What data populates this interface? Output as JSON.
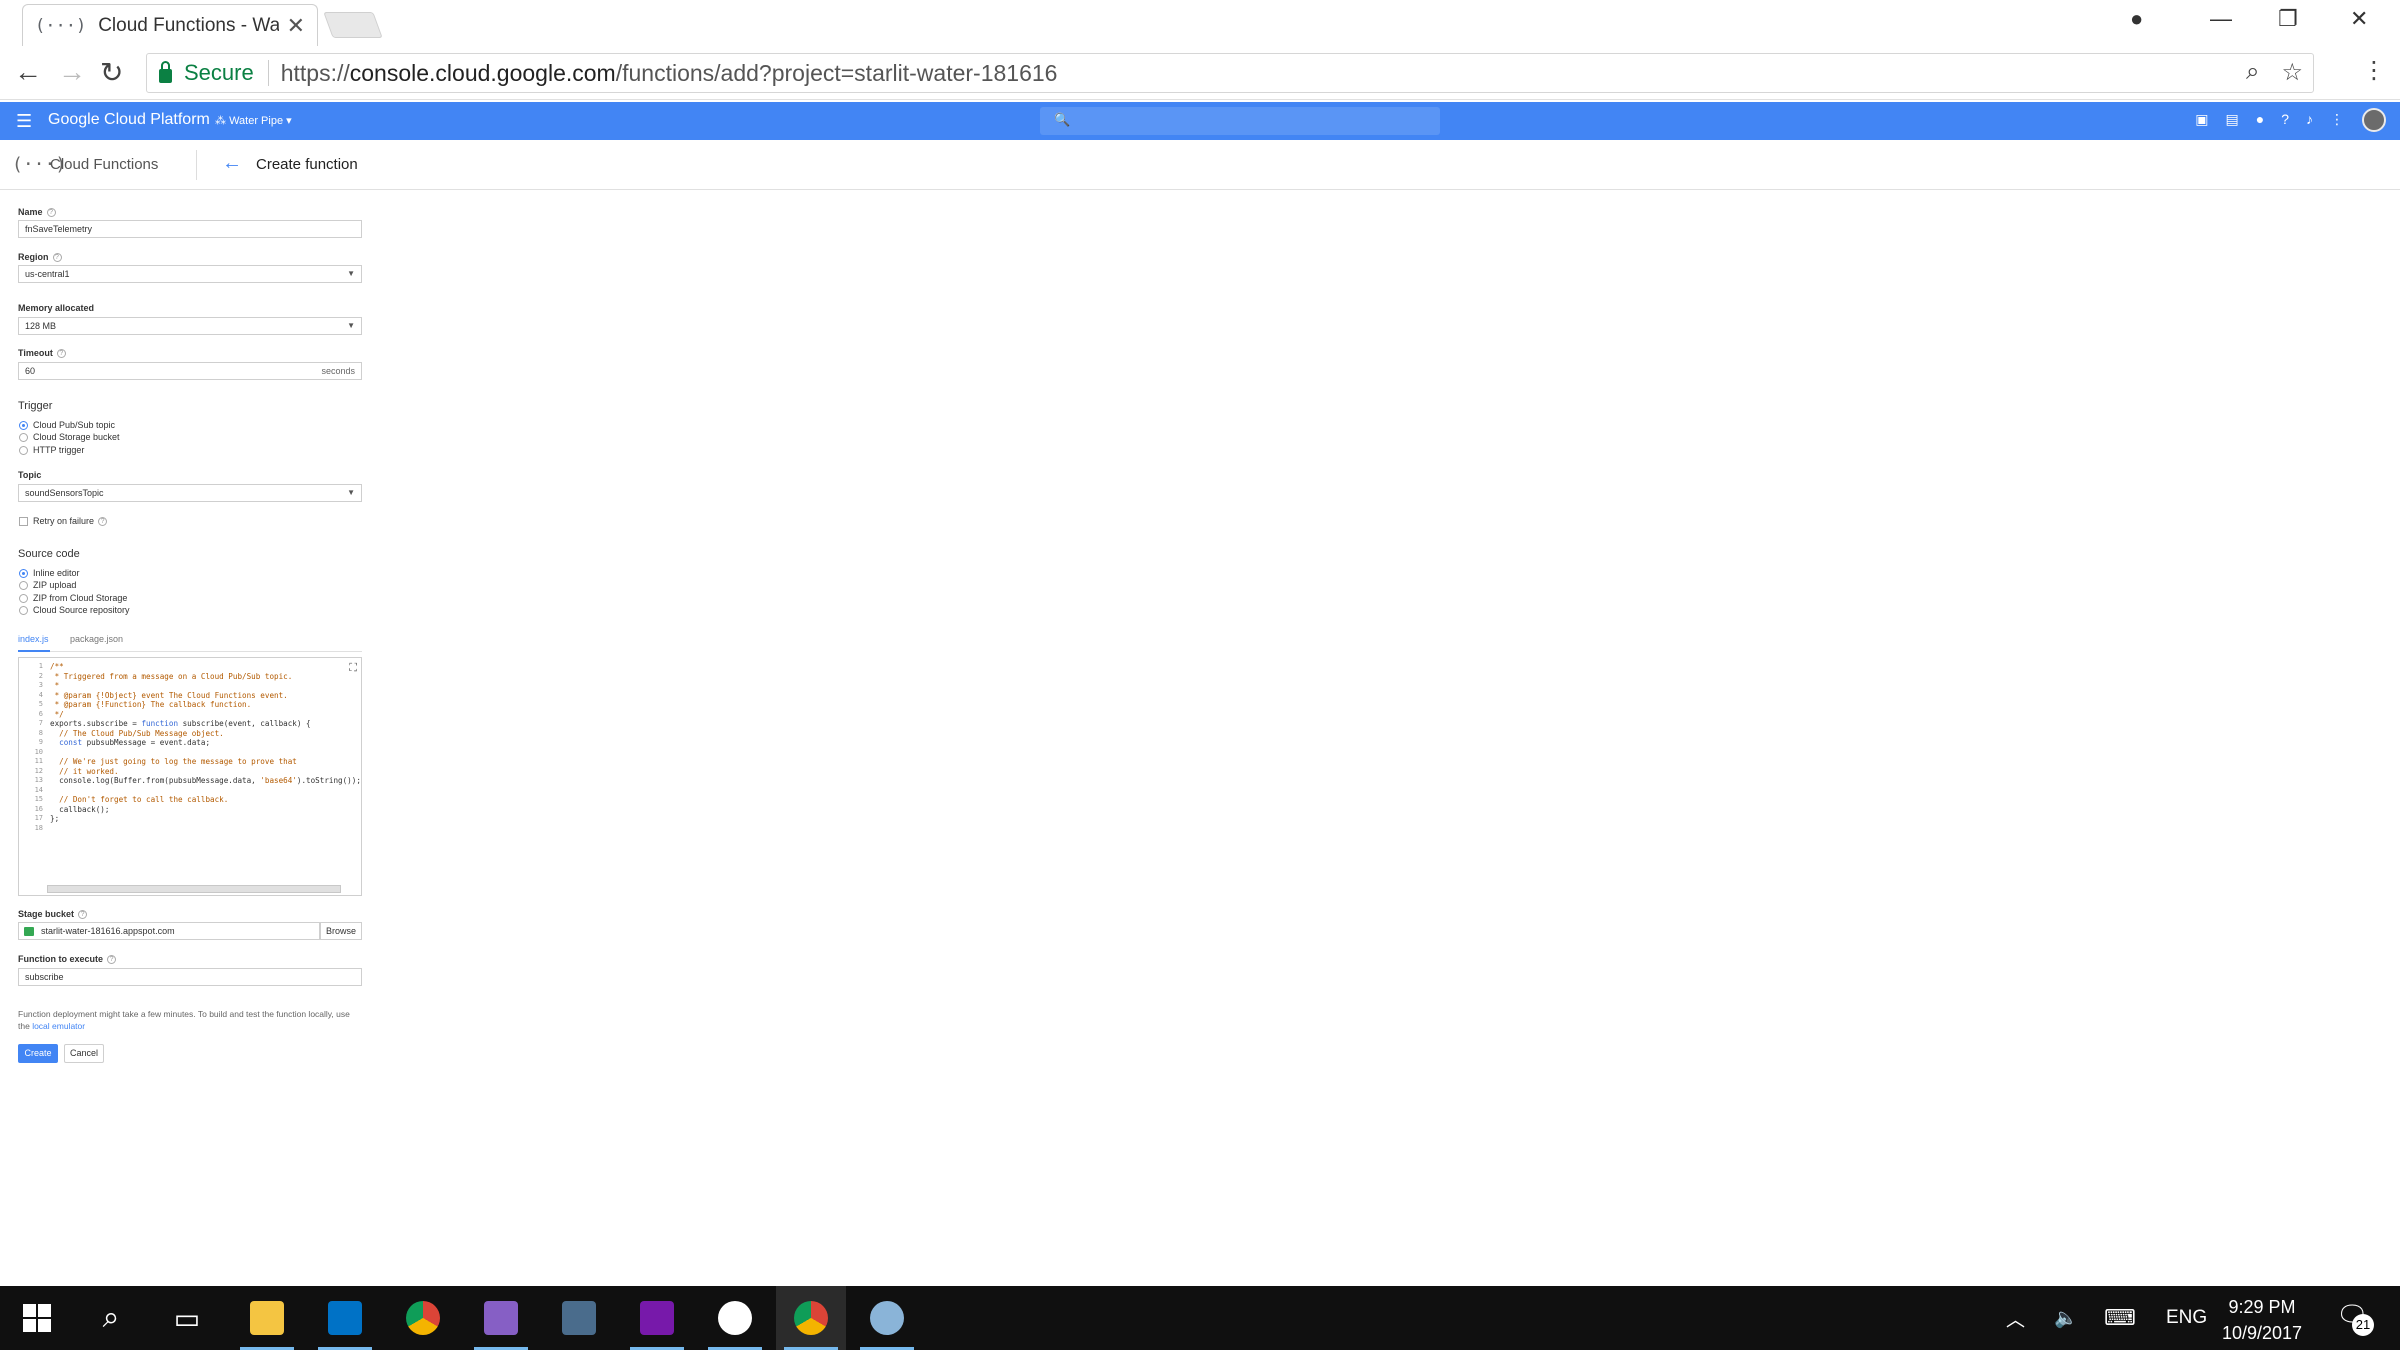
{
  "browser": {
    "tab_title": "Cloud Functions - Water",
    "tab_favicon": "(···)",
    "secure_label": "Secure",
    "url_scheme": "https://",
    "url_host": "console.cloud.google.com",
    "url_path": "/functions/add?project=starlit-water-181616"
  },
  "gcp": {
    "title": "Google Cloud Platform",
    "project": "Water Pipe"
  },
  "header": {
    "product": "Cloud Functions",
    "page_title": "Create function"
  },
  "form": {
    "name_label": "Name",
    "name_value": "fnSaveTelemetry",
    "region_label": "Region",
    "region_value": "us-central1",
    "memory_label": "Memory allocated",
    "memory_value": "128 MB",
    "timeout_label": "Timeout",
    "timeout_value": "60",
    "timeout_unit": "seconds",
    "trigger_section": "Trigger",
    "trigger_options": [
      "Cloud Pub/Sub topic",
      "Cloud Storage bucket",
      "HTTP trigger"
    ],
    "trigger_selected": 0,
    "topic_label": "Topic",
    "topic_value": "soundSensorsTopic",
    "retry_label": "Retry on failure",
    "source_section": "Source code",
    "source_options": [
      "Inline editor",
      "ZIP upload",
      "ZIP from Cloud Storage",
      "Cloud Source repository"
    ],
    "source_selected": 0,
    "code_tabs": [
      "index.js",
      "package.json"
    ],
    "stage_label": "Stage bucket",
    "stage_value": "starlit-water-181616.appspot.com",
    "browse_label": "Browse",
    "exec_label": "Function to execute",
    "exec_value": "subscribe",
    "note_text": "Function deployment might take a few minutes. To build and test the function locally, use the ",
    "note_link": "local emulator",
    "create_label": "Create",
    "cancel_label": "Cancel"
  },
  "code_lines": [
    "/**",
    " * Triggered from a message on a Cloud Pub/Sub topic.",
    " *",
    " * @param {!Object} event The Cloud Functions event.",
    " * @param {!Function} The callback function.",
    " */",
    "exports.subscribe = function subscribe(event, callback) {",
    "  // The Cloud Pub/Sub Message object.",
    "  const pubsubMessage = event.data;",
    "",
    "  // We're just going to log the message to prove that",
    "  // it worked.",
    "  console.log(Buffer.from(pubsubMessage.data, 'base64').toString());",
    "",
    "  // Don't forget to call the callback.",
    "  callback();",
    "};",
    ""
  ],
  "taskbar": {
    "language": "ENG",
    "time": "9:29 PM",
    "date": "10/9/2017",
    "notifications": "21"
  },
  "colors": {
    "gcp_blue": "#4285f4",
    "secure_green": "#0b8043",
    "taskbar": "#101010"
  }
}
